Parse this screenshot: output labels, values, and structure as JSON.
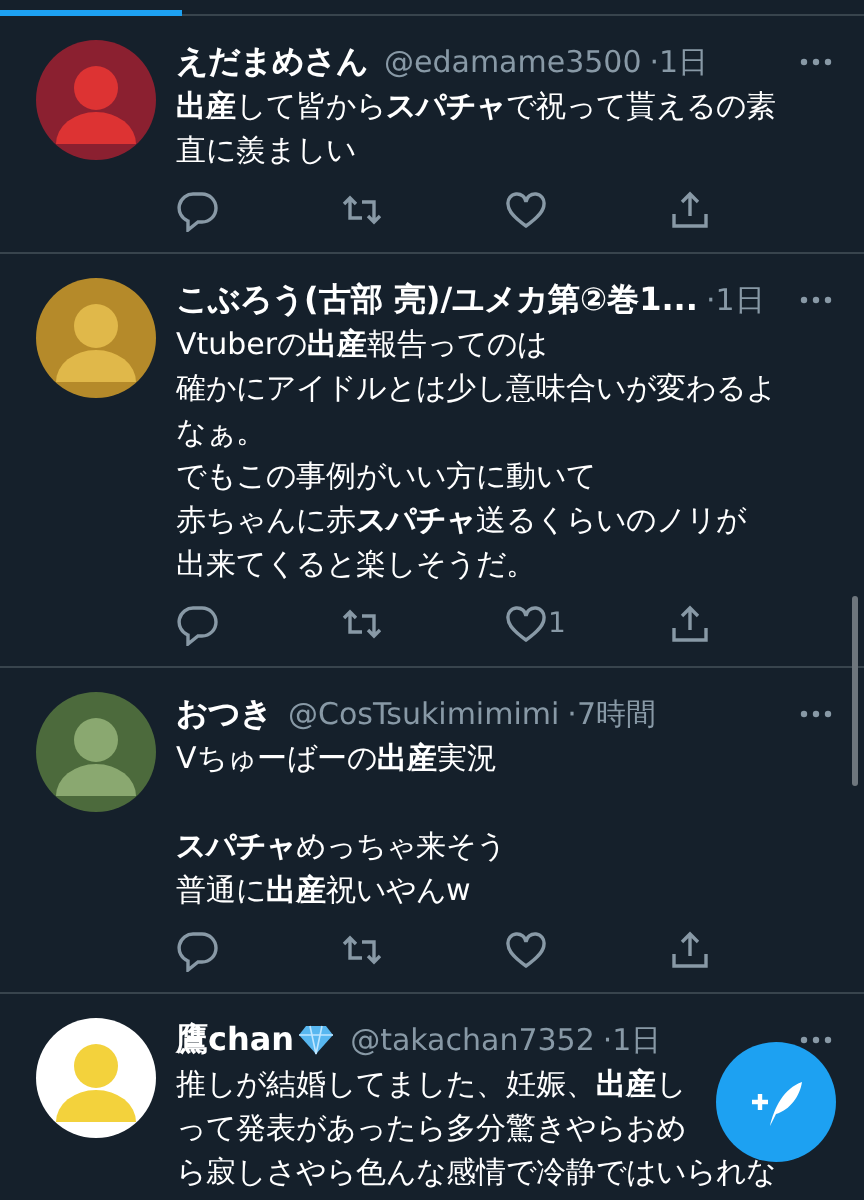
{
  "tweets": [
    {
      "name": "えだまめさん",
      "diamond": false,
      "handle": "@edamame3500",
      "time": "·1日",
      "paragraphs": [
        [
          "**出産**して皆から**スパチャ**で祝って貰えるの素",
          "直に羨ましい"
        ]
      ],
      "actions": true
    },
    {
      "name": "こぶろう(古部 亮)/ユメカ第②巻1...",
      "diamond": false,
      "time": "·1日",
      "paragraphs": [
        [
          "Vtuberの**出産**報告ってのは",
          "確かにアイドルとは少し意味合いが変わるよ",
          "なぁ。",
          "でもこの事例がいい方に動いて",
          "赤ちゃんに赤**スパチャ**送るくらいのノリが",
          "出来てくると楽しそうだ。"
        ]
      ],
      "likes": "1",
      "actions": true
    },
    {
      "name": "おつき",
      "diamond": false,
      "handle": "@CosTsukimimimi",
      "time": "·7時間",
      "paragraphs": [
        [
          "Vちゅーばーの**出産**実況"
        ],
        [
          "**スパチャ**めっちゃ来そう",
          "普通に**出産**祝いやんw"
        ]
      ],
      "actions": true
    },
    {
      "name": "鷹chan",
      "diamond": true,
      "handle": "@takachan7352",
      "time": "·1日",
      "paragraphs": [
        [
          "推しが結婚してました、妊娠、**出産**し",
          "って発表があったら多分驚きやらおめ",
          "ら寂しさやら色んな感情で冷静ではいられな"
        ]
      ],
      "actions": false
    }
  ]
}
